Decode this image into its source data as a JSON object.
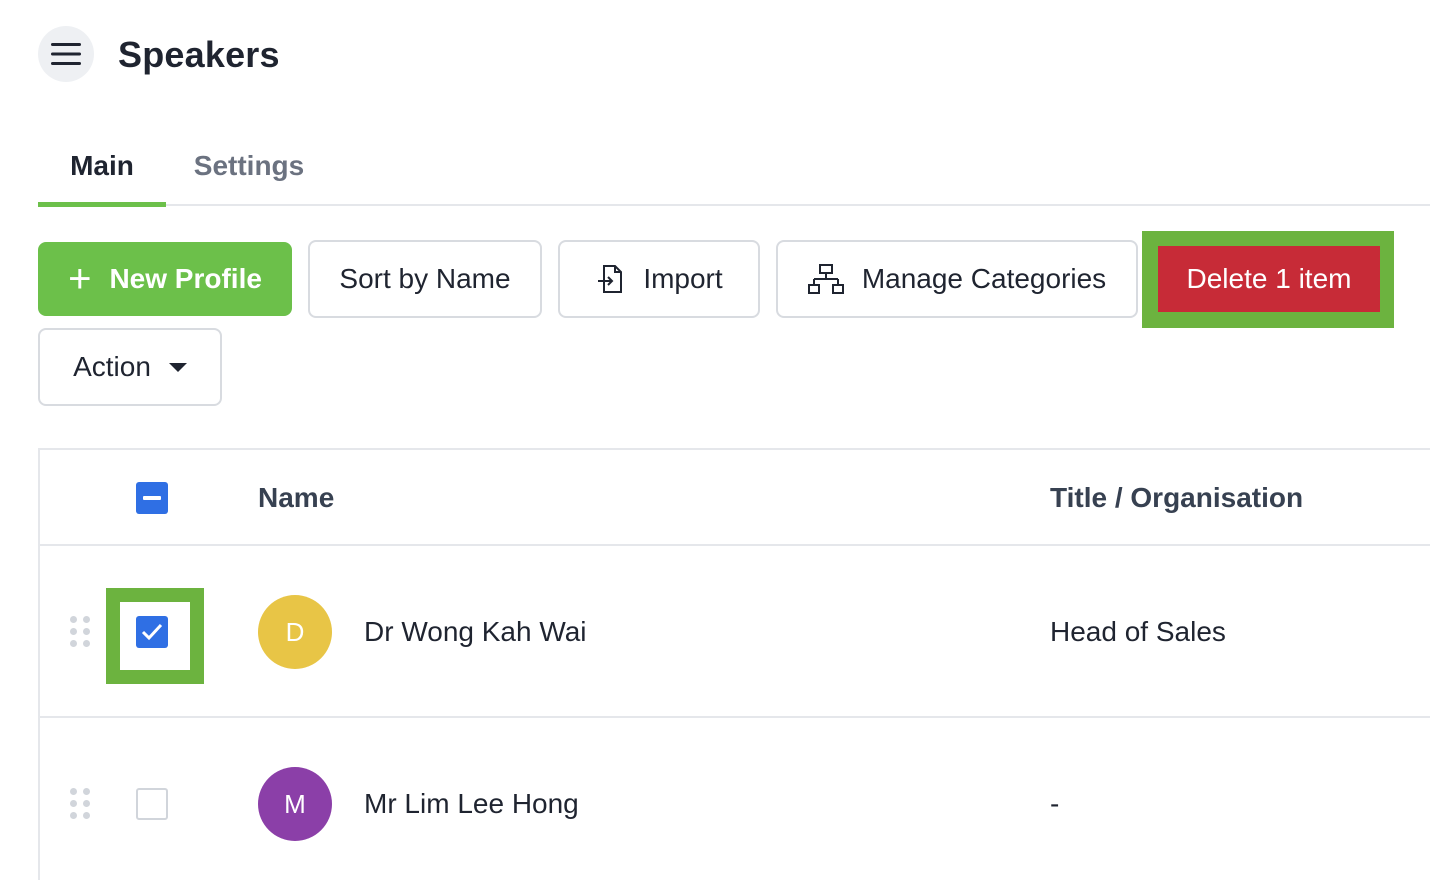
{
  "header": {
    "title": "Speakers",
    "menu_icon": "hamburger-menu-icon"
  },
  "tabs": [
    {
      "label": "Main",
      "active": true
    },
    {
      "label": "Settings",
      "active": false
    }
  ],
  "toolbar": {
    "new_profile_label": "New Profile",
    "sort_label": "Sort by Name",
    "import_label": "Import",
    "manage_categories_label": "Manage Categories",
    "delete_label": "Delete 1 item",
    "action_label": "Action"
  },
  "table": {
    "columns": [
      "Name",
      "Title / Organisation"
    ],
    "select_all_state": "indeterminate",
    "rows": [
      {
        "initial": "D",
        "avatar_color": "#e8c546",
        "name": "Dr Wong Kah Wai",
        "title": "Head of Sales",
        "selected": true
      },
      {
        "initial": "M",
        "avatar_color": "#8b3fa8",
        "name": "Mr Lim Lee Hong",
        "title": "-",
        "selected": false
      }
    ]
  },
  "colors": {
    "accent_green": "#6cc04a",
    "highlight_green": "#6cb33f",
    "danger_red": "#c72b37",
    "checkbox_blue": "#2f6fe4"
  }
}
